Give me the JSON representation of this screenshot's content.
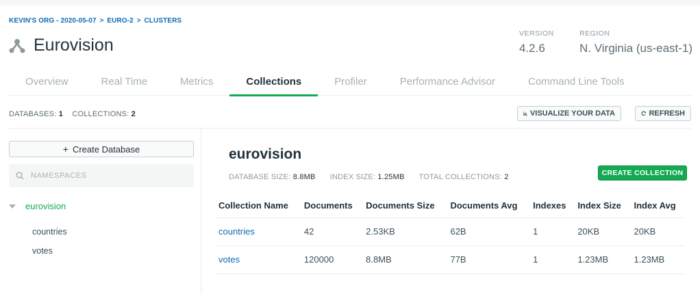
{
  "breadcrumb": [
    "KEVIN'S ORG - 2020-05-07",
    "EURO-2",
    "CLUSTERS"
  ],
  "breadcrumb_separator": ">",
  "cluster": {
    "icon": "cluster-icon",
    "name": "Eurovision",
    "version_label": "VERSION",
    "version": "4.2.6",
    "region_label": "REGION",
    "region": "N. Virginia (us-east-1)"
  },
  "tabs": [
    {
      "label": "Overview",
      "active": false
    },
    {
      "label": "Real Time",
      "active": false
    },
    {
      "label": "Metrics",
      "active": false
    },
    {
      "label": "Collections",
      "active": true
    },
    {
      "label": "Profiler",
      "active": false
    },
    {
      "label": "Performance Advisor",
      "active": false
    },
    {
      "label": "Command Line Tools",
      "active": false
    }
  ],
  "summary": {
    "databases_label": "DATABASES:",
    "databases_count": "1",
    "collections_label": "COLLECTIONS:",
    "collections_count": "2"
  },
  "toolbar": {
    "visualize_label": "VISUALIZE YOUR DATA",
    "visualize_icon": "bar-chart-icon",
    "refresh_label": "REFRESH",
    "refresh_icon": "refresh-icon"
  },
  "sidebar": {
    "create_database_label": "Create Database",
    "search_placeholder": "NAMESPACES",
    "search_icon": "search-icon",
    "databases": [
      {
        "name": "eurovision",
        "collections": [
          "countries",
          "votes"
        ]
      }
    ]
  },
  "main": {
    "db_name": "eurovision",
    "db_size_label": "DATABASE SIZE:",
    "db_size": "8.8MB",
    "index_size_label": "INDEX SIZE:",
    "index_size": "1.25MB",
    "total_collections_label": "TOTAL COLLECTIONS:",
    "total_collections": "2",
    "create_collection_label": "CREATE COLLECTION",
    "table": {
      "columns": [
        "Collection Name",
        "Documents",
        "Documents Size",
        "Documents Avg",
        "Indexes",
        "Index Size",
        "Index Avg"
      ],
      "rows": [
        [
          "countries",
          "42",
          "2.53KB",
          "62B",
          "1",
          "20KB",
          "20KB"
        ],
        [
          "votes",
          "120000",
          "8.8MB",
          "77B",
          "1",
          "1.23MB",
          "1.23MB"
        ]
      ]
    }
  },
  "colors": {
    "accent_green": "#13aa52",
    "link_blue": "#0e6cb6",
    "text_dark": "#21313c"
  }
}
